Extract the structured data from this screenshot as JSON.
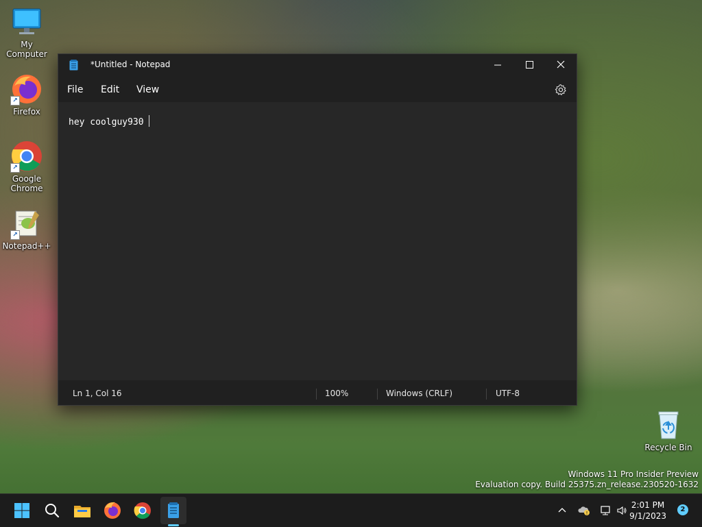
{
  "desktop": {
    "icons": [
      {
        "label": "My Computer"
      },
      {
        "label": "Firefox"
      },
      {
        "label": "Google Chrome"
      },
      {
        "label": "Notepad++"
      },
      {
        "label": "Recycle Bin"
      }
    ],
    "watermark": {
      "line1": "Windows 11 Pro Insider Preview",
      "line2": "Evaluation copy. Build 25375.zn_release.230520-1632"
    }
  },
  "window": {
    "title": "*Untitled - Notepad",
    "menu": {
      "file": "File",
      "edit": "Edit",
      "view": "View"
    },
    "content": "hey coolguy930",
    "status": {
      "position": "Ln 1, Col 16",
      "zoom": "100%",
      "line_endings": "Windows (CRLF)",
      "encoding": "UTF-8"
    }
  },
  "taskbar": {
    "clock_time": "2:01 PM",
    "clock_date": "9/1/2023",
    "notifications": "2"
  },
  "colors": {
    "accent": "#60cdff",
    "window_bg": "#202020",
    "editor_bg": "#272727"
  }
}
